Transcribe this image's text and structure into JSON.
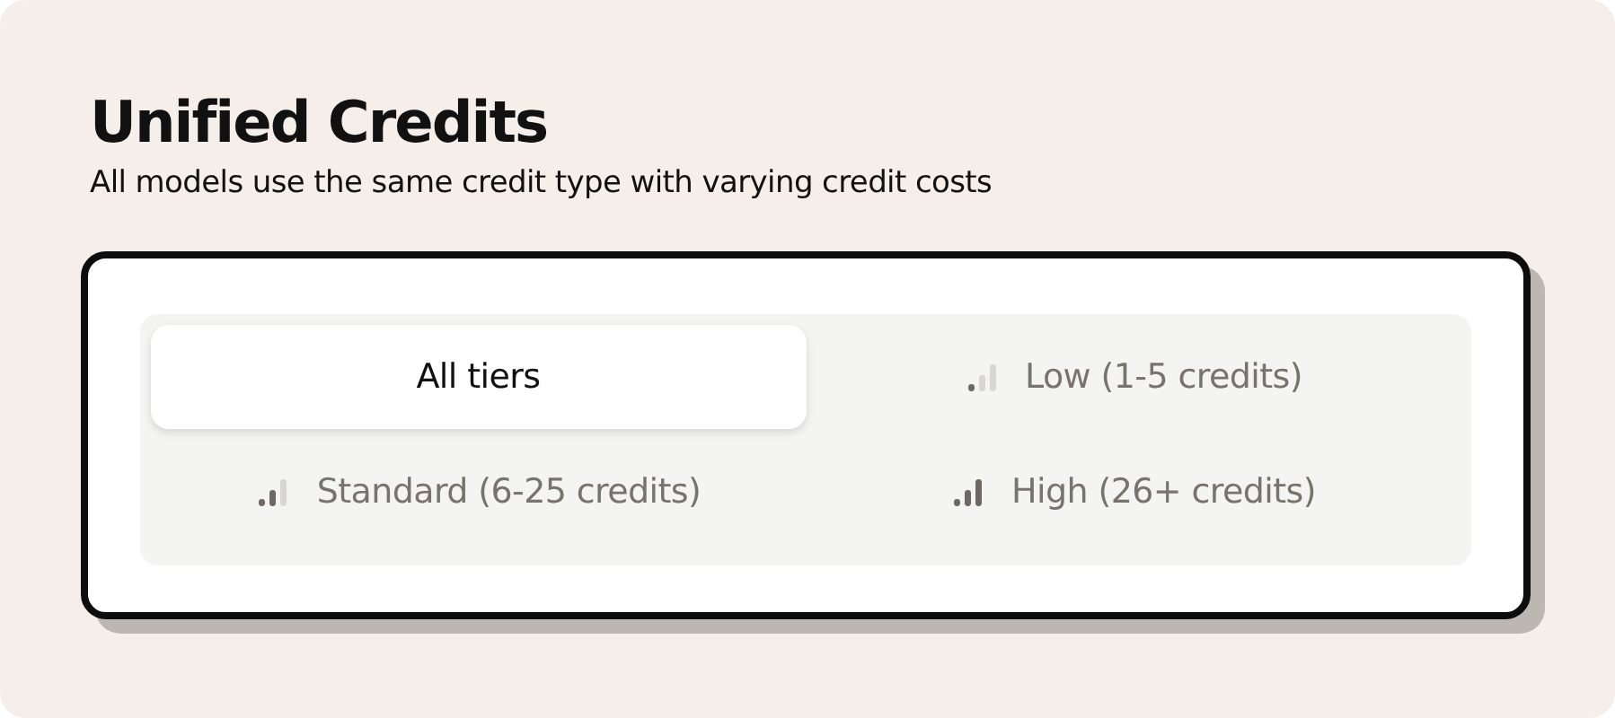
{
  "heading": {
    "title": "Unified Credits",
    "subtitle": "All models use the same credit type with varying credit costs"
  },
  "tiers": [
    {
      "label": "All tiers",
      "kind": "all",
      "selected": true
    },
    {
      "label": "Low (1-5 credits)",
      "kind": "low",
      "selected": false
    },
    {
      "label": "Standard (6-25 credits)",
      "kind": "standard",
      "selected": false
    },
    {
      "label": "High (26+ credits)",
      "kind": "high",
      "selected": false
    }
  ]
}
